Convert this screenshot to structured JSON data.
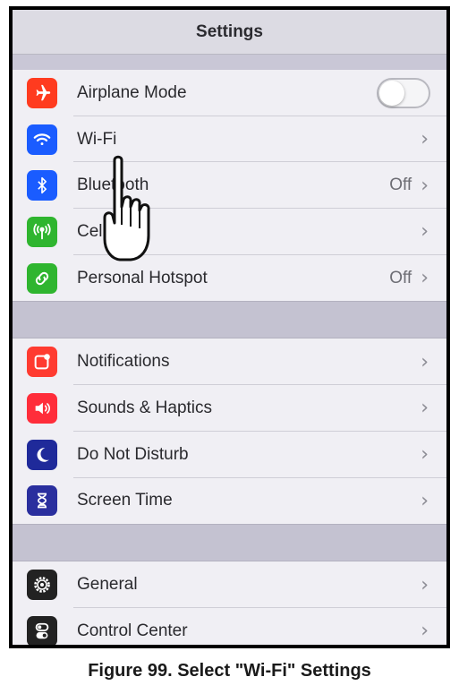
{
  "header": {
    "title": "Settings"
  },
  "groups": [
    {
      "rows": [
        {
          "label": "Airplane Mode",
          "icon": "airplane-icon",
          "color": "#ff3b1f",
          "control": "toggle",
          "toggle_on": false
        },
        {
          "label": "Wi-Fi",
          "icon": "wifi-icon",
          "color": "#1a5cff",
          "control": "chevron"
        },
        {
          "label": "Bluetooth",
          "icon": "bluetooth-icon",
          "color": "#1a5cff",
          "value": "Off",
          "control": "chevron"
        },
        {
          "label": "Cellular",
          "icon": "cellular-icon",
          "color": "#2fb52f",
          "control": "chevron"
        },
        {
          "label": "Personal Hotspot",
          "icon": "hotspot-icon",
          "color": "#2fb52f",
          "value": "Off",
          "control": "chevron"
        }
      ]
    },
    {
      "rows": [
        {
          "label": "Notifications",
          "icon": "notifications-icon",
          "color": "#ff3b30",
          "control": "chevron"
        },
        {
          "label": "Sounds & Haptics",
          "icon": "sounds-icon",
          "color": "#ff2d3a",
          "control": "chevron"
        },
        {
          "label": "Do Not Disturb",
          "icon": "moon-icon",
          "color": "#1f2a9a",
          "control": "chevron"
        },
        {
          "label": "Screen Time",
          "icon": "hourglass-icon",
          "color": "#2a2f9e",
          "control": "chevron"
        }
      ]
    },
    {
      "rows": [
        {
          "label": "General",
          "icon": "gear-icon",
          "color": "#222222",
          "control": "chevron"
        },
        {
          "label": "Control Center",
          "icon": "control-center-icon",
          "color": "#222222",
          "control": "chevron"
        }
      ]
    }
  ],
  "chevron_glyph": "›",
  "pointer": "hand-pointer-icon",
  "caption": "Figure 99.   Select \"Wi-Fi\" Settings"
}
